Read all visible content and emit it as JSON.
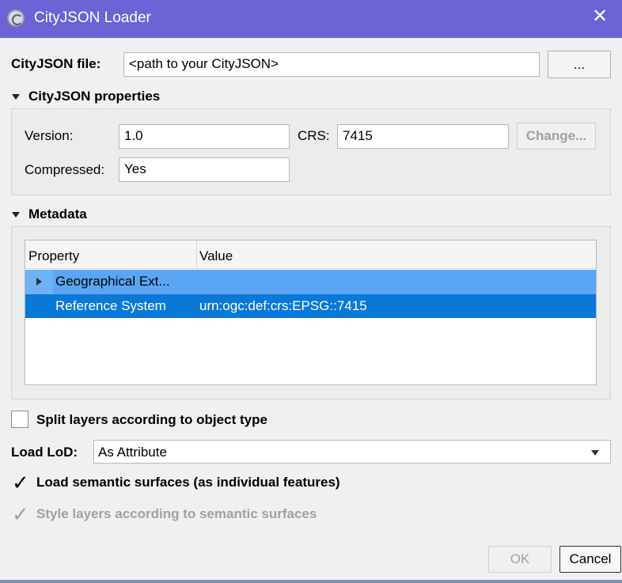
{
  "window": {
    "title": "CityJSON Loader",
    "close_glyph": "✕",
    "app_icon": "qgis-logo-icon"
  },
  "file": {
    "label": "CityJSON file:",
    "value": "<path to your CityJSON>",
    "browse_label": "..."
  },
  "properties": {
    "section_label": "CityJSON properties",
    "version_label": "Version:",
    "version_value": "1.0",
    "crs_label": "CRS:",
    "crs_value": "7415",
    "change_label": "Change...",
    "compressed_label": "Compressed:",
    "compressed_value": "Yes"
  },
  "metadata": {
    "section_label": "Metadata",
    "columns": [
      "Property",
      "Value"
    ],
    "rows": [
      {
        "property": "Geographical Ext...",
        "value": "",
        "expandable": true
      },
      {
        "property": "Reference System",
        "value": "urn:ogc:def:crs:EPSG::7415",
        "expandable": false
      }
    ]
  },
  "options": {
    "split_layers_label": "Split layers according to object type",
    "split_layers_checked": false,
    "load_lod_label": "Load LoD:",
    "load_lod_value": "As Attribute",
    "semantic_surfaces_label": "Load semantic surfaces (as individual features)",
    "semantic_surfaces_checked": true,
    "style_layers_label": "Style layers according to semantic surfaces",
    "style_layers_checked": true,
    "style_layers_enabled": false
  },
  "buttons": {
    "ok_label": "OK",
    "cancel_label": "Cancel"
  },
  "colors": {
    "titlebar": "#6b63d6",
    "selected_row": "#0a78d7",
    "highlight_row": "#6fb1f6",
    "disabled_text": "#a0a0a0"
  }
}
